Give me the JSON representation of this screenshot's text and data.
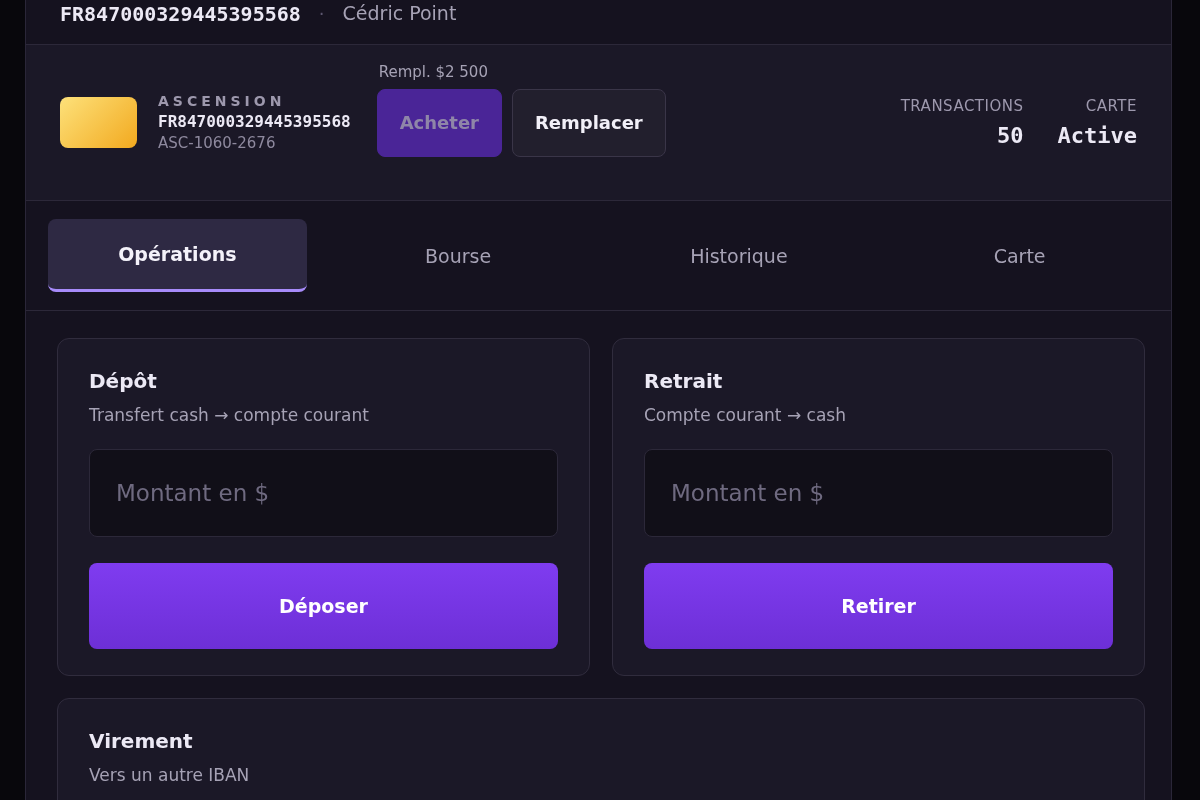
{
  "header": {
    "iban": "FR847000329445395568",
    "separator": "·",
    "owner": "Cédric Point"
  },
  "account": {
    "brand": "ASCENSION",
    "iban": "FR847000329445395568",
    "code": "ASC-1060-2676",
    "replacement_note": "Rempl. $2 500",
    "buttons": [
      {
        "label": "Acheter",
        "kind": "primary",
        "disabled": true
      },
      {
        "label": "Remplacer",
        "kind": "secondary",
        "disabled": false
      }
    ],
    "stats": [
      {
        "label": "TRANSACTIONS",
        "value": "50"
      },
      {
        "label": "CARTE",
        "value": "Active"
      }
    ]
  },
  "tabs": [
    {
      "label": "Opérations",
      "selected": true
    },
    {
      "label": "Bourse",
      "selected": false
    },
    {
      "label": "Historique",
      "selected": false
    },
    {
      "label": "Carte",
      "selected": false
    }
  ],
  "operations": [
    {
      "title": "Dépôt",
      "subtitle": "Transfert cash → compte courant",
      "placeholder": "Montant en $",
      "action": "Déposer"
    },
    {
      "title": "Retrait",
      "subtitle": "Compte courant → cash",
      "placeholder": "Montant en $",
      "action": "Retirer"
    }
  ],
  "transfer": {
    "title": "Virement",
    "subtitle": "Vers un autre IBAN"
  }
}
